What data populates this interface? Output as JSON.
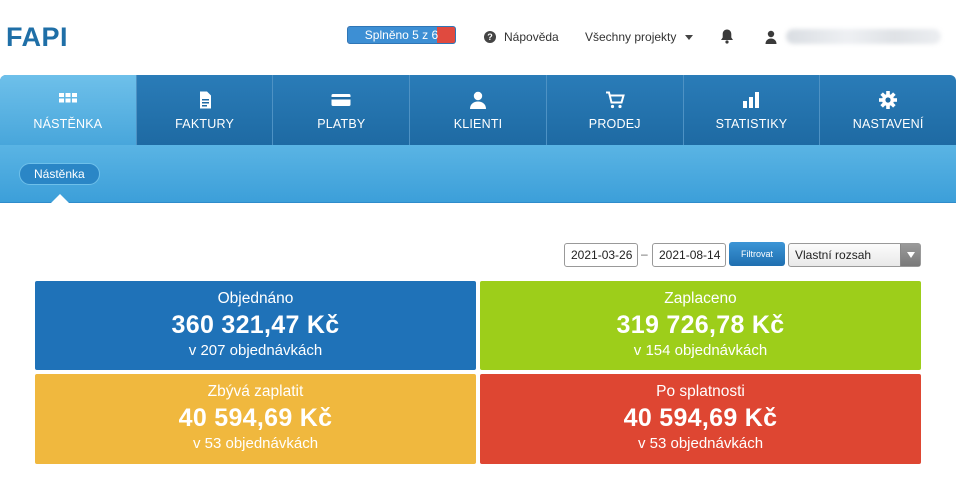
{
  "header": {
    "logo": "FAPI",
    "progress": {
      "label": "Splněno 5 z 6",
      "done": 5,
      "total": 6
    },
    "help_label": "Nápověda",
    "projects_label": "Všechny projekty",
    "icons": {
      "help": "question-circle-icon",
      "bell": "bell-icon",
      "user": "user-icon",
      "caret": "chevron-down-icon"
    }
  },
  "nav": {
    "items": [
      {
        "label": "NÁSTĚNKA",
        "icon": "dashboard-icon",
        "active": true
      },
      {
        "label": "FAKTURY",
        "icon": "document-icon",
        "active": false
      },
      {
        "label": "PLATBY",
        "icon": "credit-card-icon",
        "active": false
      },
      {
        "label": "KLIENTI",
        "icon": "user-icon",
        "active": false
      },
      {
        "label": "PRODEJ",
        "icon": "cart-icon",
        "active": false
      },
      {
        "label": "STATISTIKY",
        "icon": "bar-chart-icon",
        "active": false
      },
      {
        "label": "NASTAVENÍ",
        "icon": "gear-icon",
        "active": false
      }
    ]
  },
  "subnav": {
    "breadcrumb": "Nástěnka"
  },
  "filter": {
    "date_from": "2021-03-26",
    "date_to": "2021-08-14",
    "separator": "–",
    "button_label": "Filtrovat",
    "range_selected": "Vlastní rozsah"
  },
  "stats": {
    "ordered": {
      "label": "Objednáno",
      "value": "360 321,47 Kč",
      "sub": "v 207 objednávkách",
      "color": "#1f72b8"
    },
    "paid": {
      "label": "Zaplaceno",
      "value": "319 726,78 Kč",
      "sub": "v 154 objednávkách",
      "color": "#9dce1a"
    },
    "remaining": {
      "label": "Zbývá zaplatit",
      "value": "40 594,69 Kč",
      "sub": "v 53 objednávkách",
      "color": "#f0b83e"
    },
    "overdue": {
      "label": "Po splatnosti",
      "value": "40 594,69 Kč",
      "sub": "v 53 objednávkách",
      "color": "#de4632"
    }
  },
  "colors": {
    "brand": "#1f6fa7",
    "nav": "#1e6aa3",
    "nav_active": "#48a6db"
  }
}
